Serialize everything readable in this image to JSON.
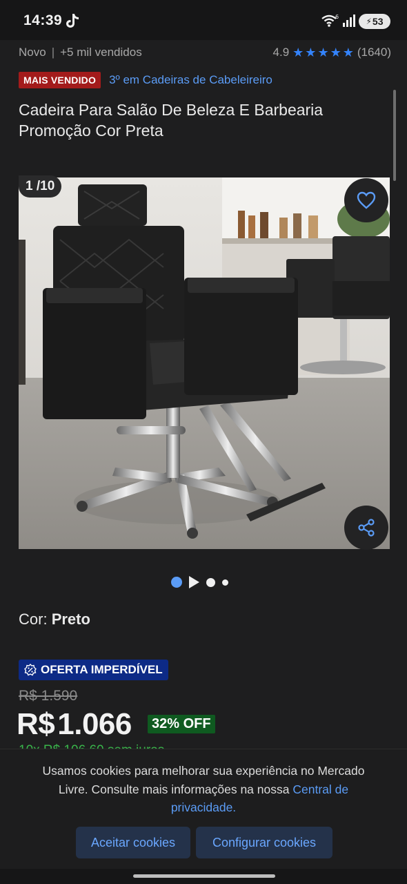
{
  "status_bar": {
    "time": "14:39",
    "battery": "53"
  },
  "meta": {
    "condition": "Novo",
    "sold": "+5 mil vendidos",
    "rating": "4.9",
    "reviews": "(1640)"
  },
  "badges": {
    "best_seller": "MAIS VENDIDO",
    "ranking": "3º em Cadeiras de Cabeleireiro"
  },
  "product": {
    "title": "Cadeira Para Salão De Beleza E Barbearia Promoção Cor Preta"
  },
  "gallery": {
    "counter": "1 /10",
    "total": 10,
    "current": 1
  },
  "variant": {
    "label": "Cor:",
    "value": "Preto"
  },
  "offer": {
    "label": "OFERTA IMPERDÍVEL"
  },
  "pricing": {
    "old_price": "R$ 1.590",
    "currency": "R$",
    "price": "1.066",
    "discount": "32% OFF",
    "installments": "10x R$ 106,60 sem juros"
  },
  "cookie_banner": {
    "text": "Usamos cookies para melhorar sua experiência no Mercado Livre. Consulte mais informações na nossa",
    "link": "Central de privacidade.",
    "accept": "Aceitar cookies",
    "configure": "Configurar cookies"
  },
  "colors": {
    "accent": "#3483fa",
    "best_seller": "#a31b1b",
    "offer": "#0d2a86",
    "discount": "#0f5a20",
    "installment": "#39b54a"
  },
  "icons": [
    "tiktok-icon",
    "wifi-icon",
    "signal-icon",
    "star-icon",
    "heart-icon",
    "share-icon",
    "offer-icon",
    "play-icon"
  ]
}
